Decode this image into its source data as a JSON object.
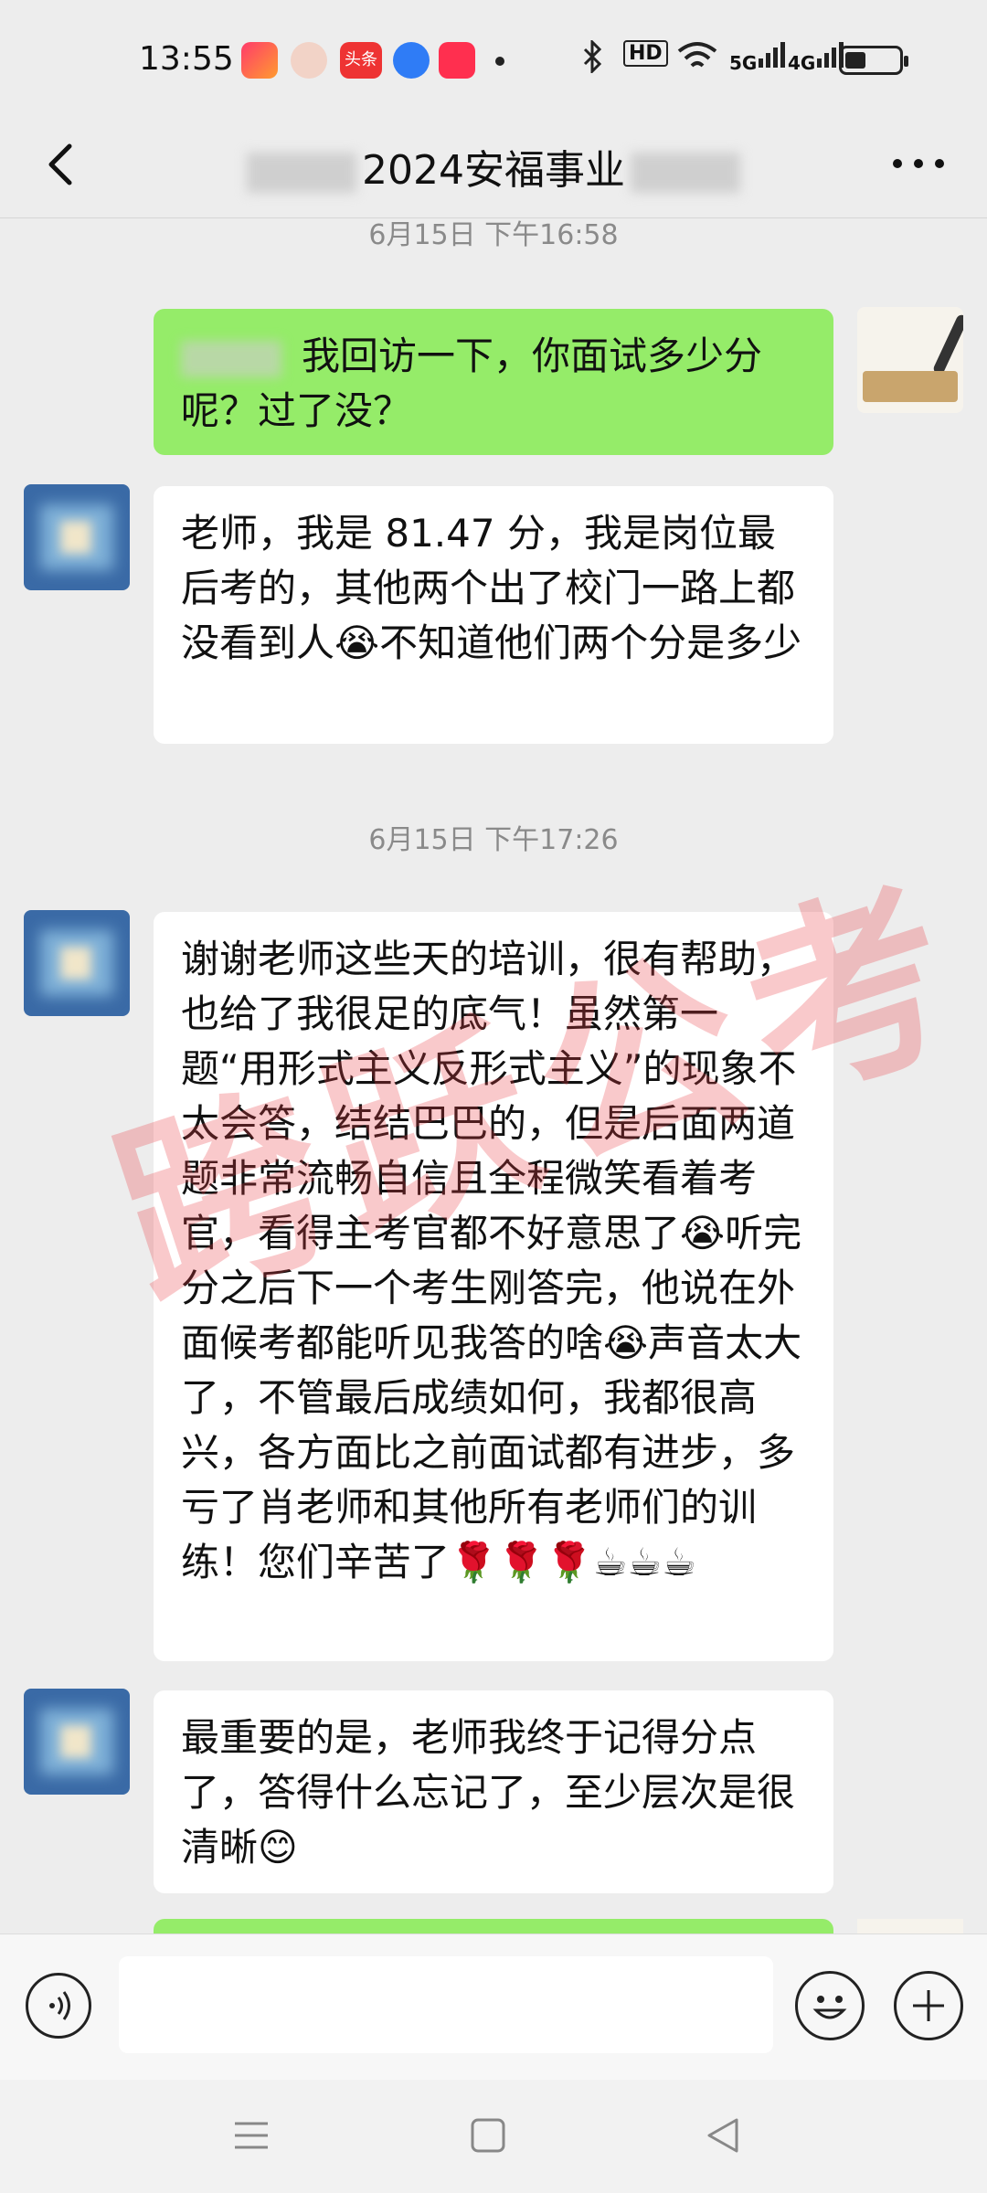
{
  "status_bar": {
    "time": "13:55",
    "app_icons": [
      "video-app-icon",
      "avatar-app-icon",
      "toutiao-app-icon",
      "service-app-icon",
      "play-app-icon"
    ],
    "toutiao_label": "头条",
    "hd_label": "HD",
    "net_5g": "5G",
    "net_4g": "4G"
  },
  "header": {
    "title": "2024安福事业"
  },
  "messages": [
    {
      "type": "timestamp",
      "text": "6月15日 下午16:58"
    },
    {
      "type": "mine",
      "text": "我回访一下，你面试多少分呢？过了没？"
    },
    {
      "type": "other",
      "text": "老师，我是 81.47 分，我是岗位最后考的，其他两个出了校门一路上都没看到人😭不知道他们两个分是多少"
    },
    {
      "type": "timestamp",
      "text": "6月15日 下午17:26"
    },
    {
      "type": "other",
      "text": "谢谢老师这些天的培训，很有帮助，也给了我很足的底气！虽然第一题“用形式主义反形式主义”的现象不太会答，结结巴巴的，但是后面两道题非常流畅自信且全程微笑看着考官，看得主考官都不好意思了😭听完分之后下一个考生刚答完，他说在外面候考都能听见我答的啥😭声音太大了，不管最后成绩如何，我都很高兴，各方面比之前面试都有进步，多亏了肖老师和其他所有老师们的训练！您们辛苦了🌹🌹🌹☕☕☕"
    },
    {
      "type": "other",
      "text": "最重要的是，老师我终于记得分点了，答得什么忘记了，至少层次是很清晰😊"
    }
  ],
  "avatar_mine_label": "跨跃公考",
  "watermark": "跨跃公考",
  "input": {
    "placeholder": ""
  },
  "colors": {
    "background": "#ededed",
    "my_bubble": "#95ec69",
    "other_bubble": "#ffffff"
  }
}
